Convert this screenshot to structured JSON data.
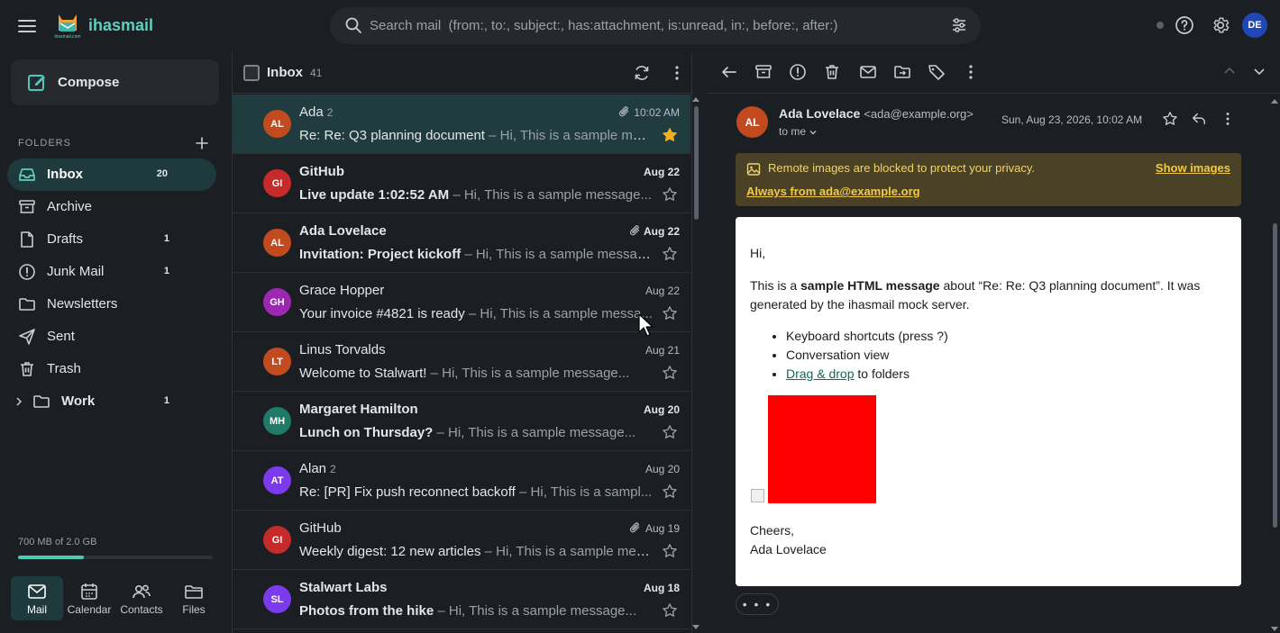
{
  "app": {
    "brand": "ihasmail",
    "logo_text": "ihasmail.com"
  },
  "search": {
    "placeholder": "Search mail  (from:, to:, subject:, has:attachment, is:unread, in:, before:, after:)"
  },
  "user": {
    "initials": "DE"
  },
  "sidebar": {
    "compose_label": "Compose",
    "folders_heading": "FOLDERS",
    "items": [
      {
        "label": "Inbox",
        "count": "20",
        "icon": "inbox-icon"
      },
      {
        "label": "Archive",
        "count": "",
        "icon": "archive-icon"
      },
      {
        "label": "Drafts",
        "count": "1",
        "icon": "drafts-icon"
      },
      {
        "label": "Junk Mail",
        "count": "1",
        "icon": "junk-icon"
      },
      {
        "label": "Newsletters",
        "count": "",
        "icon": "folder-icon"
      },
      {
        "label": "Sent",
        "count": "",
        "icon": "sent-icon"
      },
      {
        "label": "Trash",
        "count": "",
        "icon": "trash-icon"
      },
      {
        "label": "Work",
        "count": "1",
        "icon": "folder-icon"
      }
    ],
    "storage_text": "700 MB of 2.0 GB",
    "storage_fraction": 0.34,
    "apps": [
      {
        "label": "Mail"
      },
      {
        "label": "Calendar"
      },
      {
        "label": "Contacts"
      },
      {
        "label": "Files"
      }
    ]
  },
  "list": {
    "title": "Inbox",
    "count": "41",
    "messages": [
      {
        "initials": "AL",
        "color": "#c14a1f",
        "from": "Ada",
        "thread": "2",
        "date": "10:02 AM",
        "subject": "Re: Re: Q3 planning document",
        "preview": "– Hi, This is a sample mes...",
        "unread": false,
        "attach": true,
        "starred": true
      },
      {
        "initials": "GI",
        "color": "#c62a2a",
        "from": "GitHub",
        "thread": "",
        "date": "Aug 22",
        "subject": "Live update 1:02:52 AM",
        "preview": "– Hi, This is a sample message...",
        "unread": true,
        "attach": false,
        "starred": false
      },
      {
        "initials": "AL",
        "color": "#c14a1f",
        "from": "Ada Lovelace",
        "thread": "",
        "date": "Aug 22",
        "subject": "Invitation: Project kickoff",
        "preview": "– Hi, This is a sample message...",
        "unread": true,
        "attach": true,
        "starred": false
      },
      {
        "initials": "GH",
        "color": "#9c27b0",
        "from": "Grace Hopper",
        "thread": "",
        "date": "Aug 22",
        "subject": "Your invoice #4821 is ready",
        "preview": "– Hi, This is a sample messa...",
        "unread": false,
        "attach": false,
        "starred": false
      },
      {
        "initials": "LT",
        "color": "#c14a1f",
        "from": "Linus Torvalds",
        "thread": "",
        "date": "Aug 21",
        "subject": "Welcome to Stalwart!",
        "preview": "– Hi, This is a sample message...",
        "unread": false,
        "attach": false,
        "starred": false
      },
      {
        "initials": "MH",
        "color": "#1f7a6a",
        "from": "Margaret Hamilton",
        "thread": "",
        "date": "Aug 20",
        "subject": "Lunch on Thursday?",
        "preview": "– Hi, This is a sample message...",
        "unread": true,
        "attach": false,
        "starred": false
      },
      {
        "initials": "AT",
        "color": "#7c3aed",
        "from": "Alan",
        "thread": "2",
        "date": "Aug 20",
        "subject": "Re: [PR] Fix push reconnect backoff",
        "preview": "– Hi, This is a sampl...",
        "unread": false,
        "attach": false,
        "starred": false
      },
      {
        "initials": "GI",
        "color": "#c62a2a",
        "from": "GitHub",
        "thread": "",
        "date": "Aug 19",
        "subject": "Weekly digest: 12 new articles",
        "preview": "– Hi, This is a sample message...",
        "unread": false,
        "attach": true,
        "starred": false
      },
      {
        "initials": "SL",
        "color": "#7c3aed",
        "from": "Stalwart Labs",
        "thread": "",
        "date": "Aug 18",
        "subject": "Photos from the hike",
        "preview": "– Hi, This is a sample message...",
        "unread": true,
        "attach": false,
        "starred": false
      }
    ]
  },
  "reader": {
    "sender_initials": "AL",
    "sender_name": "Ada Lovelace",
    "sender_addr": "<ada@example.org>",
    "to": "to me",
    "date": "Sun, Aug 23, 2026, 10:02 AM",
    "banner_text": "Remote images are blocked to protect your privacy.",
    "show_images": "Show images",
    "always_from": "Always from ada@example.org",
    "greeting": "Hi,",
    "p_pre": "This is a ",
    "p_bold": "sample HTML message",
    "p_post": " about “Re: Re: Q3 planning document”. It was generated by the ihasmail mock server.",
    "bullets": [
      "Keyboard shortcuts (press ?)",
      "Conversation view"
    ],
    "link_text": "Drag & drop",
    "link_suffix": " to folders",
    "sign1": "Cheers,",
    "sign2": "Ada Lovelace",
    "expand": "• • •"
  },
  "colors": {
    "accent": "#4ec8b8",
    "banner": "#4a4227",
    "star": "#f2b01e"
  }
}
